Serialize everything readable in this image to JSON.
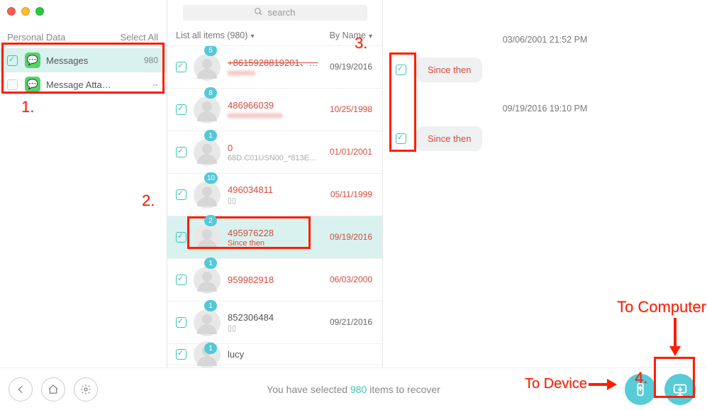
{
  "window": {
    "title": ""
  },
  "search": {
    "placeholder": "search"
  },
  "sidebar": {
    "header": "Personal Data",
    "select_all": "Select All",
    "items": [
      {
        "label": "Messages",
        "count": "980"
      },
      {
        "label": "Message Atta…",
        "count": "--"
      }
    ]
  },
  "filter": {
    "list_label": "List all items (980)",
    "sort_label": "By Name"
  },
  "contacts": [
    {
      "badge": "5",
      "name": "+8615928819201、…",
      "name_strike": true,
      "sub": "xxxxxxx",
      "sub_blur": true,
      "date": "09/19/2016",
      "date_red": false
    },
    {
      "badge": "8",
      "name": "486966039",
      "sub": "xxxxxxxxxxxxxx .",
      "sub_red": true,
      "sub_blur": true,
      "date": "10/25/1998",
      "date_red": true
    },
    {
      "badge": "1",
      "name": "0",
      "sub": "68D.C01USN00_*813E…",
      "date": "01/01/2001",
      "date_red": true
    },
    {
      "badge": "10",
      "name": "496034811",
      "sub": "▯▯",
      "date": "05/11/1999",
      "date_red": true
    },
    {
      "badge": "2",
      "name": "495976228",
      "sub": "Since then",
      "sub_red": true,
      "date": "09/19/2016",
      "date_red": true,
      "selected": true
    },
    {
      "badge": "1",
      "name": "959982918",
      "sub": "",
      "date": "06/03/2000",
      "date_red": true
    },
    {
      "badge": "1",
      "name": "852306484",
      "name_red": false,
      "sub": "▯▯",
      "date": "09/21/2016",
      "date_red": false
    },
    {
      "badge": "1",
      "name": "lucy",
      "name_red": false,
      "sub": "",
      "date": "",
      "partial": true
    }
  ],
  "chat": {
    "ts1": "03/06/2001 21:52 PM",
    "msg1": "Since then",
    "ts2": "09/19/2016 19:10 PM",
    "msg2": "Since then"
  },
  "footer": {
    "prefix": "You have selected ",
    "count": "980",
    "suffix": " items to recover"
  },
  "annotations": {
    "n1": "1.",
    "n2": "2.",
    "n3": "3.",
    "n4": "4.",
    "to_device": "To Device",
    "to_computer": "To Computer"
  }
}
